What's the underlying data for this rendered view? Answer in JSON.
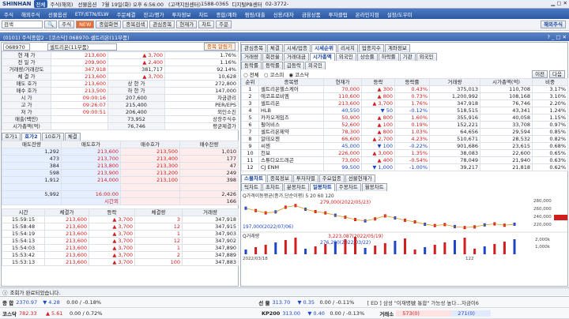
{
  "topbar": {
    "brand": "SHINHAN",
    "mode": "전체",
    "items": [
      "주식(해외)",
      "선물옵션",
      "7월 19일(화) 오후 6:56:00",
      "(고객지원센터)",
      "1588-0365",
      "디지털PB센터",
      "02-3772-",
      "...",
      "..."
    ]
  },
  "menu": [
    "주식",
    "해외주식",
    "선물옵션",
    "ETF/ETN/ELW",
    "주문체결",
    "잔고/평가",
    "투자정보",
    "차트",
    "종합/계좌",
    "펌핑/대출",
    "신용/대차",
    "금융상품",
    "투자클럽",
    "온라인지점",
    "설정/도우미"
  ],
  "toolbar": {
    "search": "검색",
    "code": "주식",
    "new": "NEW",
    "buttons": [
      "종합화면",
      "종목검색",
      "관심종목",
      "현재가",
      "차트",
      "주문"
    ],
    "brand2": "해외주식"
  },
  "window": {
    "title": "(0101) 주식종합2 - [코스닥] 068970-셀트리온(11부품)"
  },
  "left": {
    "code": "068970",
    "name": "셀트리온(11부품)",
    "alert": "종목 알림기",
    "quote": [
      [
        "현 재 가",
        "213,600",
        "▲ 3,700",
        "1.76%"
      ],
      [
        "전 일 가",
        "209,900",
        "▲ 2,400",
        "1.16%"
      ],
      [
        "거래량/거래강도",
        "347,918",
        "381,717",
        "92.14%"
      ],
      [
        "체 결 가",
        "213,600",
        "▲ 3,700",
        "10,628"
      ],
      [
        "매도 호가",
        "213,600",
        "상 한 가",
        "272,800"
      ],
      [
        "매수 호가",
        "213,500",
        "하 한 가",
        "147,000"
      ],
      [
        "시 가",
        "09:00:16",
        "207,600",
        "자금관리"
      ],
      [
        "고 가",
        "09:26:07",
        "215,400",
        "PER/EPS"
      ],
      [
        "저 가",
        "09:00:51",
        "206,400",
        "외인소진"
      ],
      [
        "매출(백만)",
        "",
        "73,952",
        "상장주식수"
      ],
      [
        "시가총액(억)",
        "",
        "76,746",
        "평균제결가"
      ]
    ],
    "quote_right": [
      "180.00",
      "0 / 0",
      "22.39%",
      "35,929,616",
      "212,556"
    ],
    "tabs": [
      "호가1",
      "호가2",
      "10호가",
      "체결"
    ],
    "ob_head": [
      "매도잔량",
      "매도호가",
      "매수호가",
      "매수잔량"
    ],
    "orderbook": [
      [
        "1,292",
        "213,600",
        "213,500",
        "1,010"
      ],
      [
        "473",
        "213,700",
        "213,400",
        "177"
      ],
      [
        "384",
        "213,800",
        "213,300",
        "47"
      ],
      [
        "598",
        "213,900",
        "213,200",
        "249"
      ],
      [
        "1,912",
        "214,000",
        "213,100",
        "398"
      ],
      [
        "",
        "",
        "",
        ""
      ],
      [
        "5,992",
        "16:00:00",
        "",
        "2,426"
      ],
      [
        "",
        "시간외",
        "",
        "166"
      ]
    ],
    "tr_head": [
      "시간",
      "체결가",
      "등락",
      "체결량",
      "거래량"
    ],
    "trades": [
      [
        "15:59:15",
        "213,600",
        "▲ 3,700",
        "3",
        "347,918"
      ],
      [
        "15:58:48",
        "213,600",
        "▲ 3,700",
        "12",
        "347,915"
      ],
      [
        "15:54:19",
        "213,600",
        "▲ 3,700",
        "1",
        "347,903"
      ],
      [
        "15:54:13",
        "213,600",
        "▲ 3,700",
        "12",
        "347,902"
      ],
      [
        "15:54:03",
        "213,600",
        "▲ 3,700",
        "1",
        "347,890"
      ],
      [
        "15:53:42",
        "213,600",
        "▲ 3,700",
        "2",
        "347,889"
      ],
      [
        "15:53:13",
        "213,600",
        "▲ 3,700",
        "100",
        "347,883"
      ]
    ]
  },
  "right": {
    "tabs1": [
      "관심종목",
      "체결",
      "시세/업종",
      "시세순위",
      "리서치",
      "업종지수",
      "계좌정보"
    ],
    "tabs2": [
      "거래량",
      "회전율",
      "거래대금",
      "시가총액",
      "외국인",
      "상승률",
      "하락률",
      "기관",
      "외국인"
    ],
    "tabs3": [
      "동락률",
      "등락률",
      "급등락",
      "외국인"
    ],
    "filter": [
      "전체",
      "코스피",
      "코스닥"
    ],
    "btns": [
      "이전",
      "다음"
    ],
    "rank_head": [
      "순위",
      "종목명",
      "현재가",
      "등락",
      "등락률",
      "거래량",
      "시가총액(억)",
      "비중"
    ],
    "ranking": [
      [
        "1",
        "셀트리온헬스케어",
        "70,000",
        "▲ 300",
        "0.43%",
        "375,013",
        "110,708",
        "3.17%"
      ],
      [
        "2",
        "에코프로비엠",
        "110,600",
        "▲ 800",
        "0.73%",
        "1,200,992",
        "108,168",
        "3.10%"
      ],
      [
        "3",
        "셀트리온",
        "213,600",
        "▲ 3,700",
        "1.76%",
        "347,918",
        "76,746",
        "2.20%"
      ],
      [
        "4",
        "HLB",
        "40,550",
        "▼ 50",
        "-0.12%",
        "518,515",
        "43,341",
        "1.24%"
      ],
      [
        "5",
        "카카오게임즈",
        "50,900",
        "▲ 800",
        "1.60%",
        "355,916",
        "40,058",
        "1.15%"
      ],
      [
        "6",
        "펄어비스",
        "52,600",
        "▲ 100",
        "0.19%",
        "152,221",
        "33,708",
        "0.97%"
      ],
      [
        "7",
        "셀트리온제약",
        "78,300",
        "▲ 800",
        "1.03%",
        "64,656",
        "29,594",
        "0.85%"
      ],
      [
        "8",
        "알테오젠",
        "66,600",
        "▲ 2,700",
        "4.23%",
        "510,671",
        "28,532",
        "0.82%"
      ],
      [
        "9",
        "씨젠",
        "45,000",
        "▼ 100",
        "-0.22%",
        "901,686",
        "23,615",
        "0.68%"
      ],
      [
        "10",
        "천보",
        "226,000",
        "▲ 3,000",
        "1.35%",
        "38,083",
        "22,600",
        "0.65%"
      ],
      [
        "11",
        "스튜디오드래곤",
        "73,000",
        "▲ 400",
        "-0.54%",
        "78,049",
        "21,940",
        "0.63%"
      ],
      [
        "12",
        "CJ ENM",
        "99,500",
        "▼ 1,000",
        "-1.00%",
        "39,217",
        "21,818",
        "0.62%"
      ]
    ],
    "charttabs": [
      "스몰차트",
      "종목정보",
      "투자자별",
      "주요업종",
      "선물현재가"
    ],
    "chartsub": [
      "틱차트",
      "초차트",
      "분봉차트",
      "일봉차트",
      "주봉차트",
      "월봉차트"
    ],
    "legend": "Q가격이동평균(종가,단순이평) 5 20 60 120",
    "hi": "279,000(2022/05/23)",
    "lo": "197,000(2022/07/06)",
    "vol_title": "Q거래량",
    "vhi": "3,223,087(2022/05/19)",
    "vlo": "276,290(2022/03/22)",
    "axis": [
      "280,000",
      "260,000",
      "240,000",
      "220,000"
    ],
    "vaxis": [
      "2,000k",
      "1,000k"
    ],
    "date": "2022/03/18",
    "page": "122",
    "chart_price": [
      262,
      255,
      248,
      251,
      265,
      270,
      259,
      252,
      248,
      241,
      235,
      228,
      224,
      230,
      239,
      233,
      226,
      221,
      214,
      210,
      213,
      207,
      204,
      206,
      212,
      215,
      211,
      214
    ]
  },
  "status": {
    "msg": "조회가 완료되었습니다."
  },
  "ticker": {
    "r1": [
      [
        "종 합",
        "2370.97",
        "▼ 4.28",
        "0.00 / -0.18%"
      ],
      [
        "선 물",
        "313.70",
        "▼ 0.35",
        "0.00 / -0.11%"
      ],
      "[ ED ] 삼성 \"이재명號 통합\" 가능성 높다…자금이6"
    ],
    "r2": [
      [
        "코스닥",
        "782.33",
        "▲ 5.61",
        "0.00 / 0.72%"
      ],
      [
        "KP200",
        "313.00",
        "▼ 0.40",
        "0.00 / -0.13%"
      ],
      [
        "거래소",
        "573(0)",
        "271(0)"
      ]
    ]
  }
}
